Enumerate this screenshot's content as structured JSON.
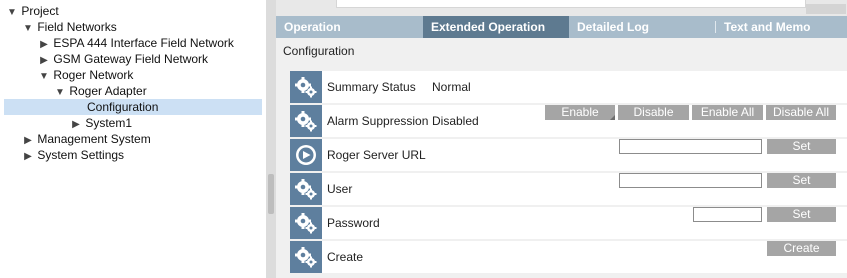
{
  "tree": {
    "items": [
      {
        "label": "Project",
        "toggle": "▼"
      },
      {
        "label": "Field Networks",
        "toggle": "▼"
      },
      {
        "label": "ESPA 444 Interface Field Network",
        "toggle": "▶"
      },
      {
        "label": "GSM Gateway Field Network",
        "toggle": "▶"
      },
      {
        "label": "Roger Network",
        "toggle": "▼"
      },
      {
        "label": "Roger Adapter",
        "toggle": "▼"
      },
      {
        "label": "Configuration",
        "toggle": ""
      },
      {
        "label": "System1",
        "toggle": "▶"
      },
      {
        "label": "Management System",
        "toggle": "▶"
      },
      {
        "label": "System Settings",
        "toggle": "▶"
      }
    ]
  },
  "tabs": [
    {
      "label": "Operation"
    },
    {
      "label": "Extended Operation"
    },
    {
      "label": "Detailed Log"
    },
    {
      "label": "Text and Memo"
    }
  ],
  "section_title": "Configuration",
  "rows": [
    {
      "label": "Summary Status",
      "value": "Normal",
      "icon": "gears-icon"
    },
    {
      "label": "Alarm Suppression",
      "value": "Disabled",
      "icon": "gears-icon",
      "buttons": [
        "Enable",
        "Disable",
        "Enable All",
        "Disable All"
      ]
    },
    {
      "label": "Roger Server URL",
      "icon": "play-circle-icon",
      "input_value": "",
      "button": "Set"
    },
    {
      "label": "User",
      "icon": "gears-icon",
      "input_value": "",
      "button": "Set"
    },
    {
      "label": "Password",
      "icon": "gears-icon",
      "input_value": "",
      "button": "Set"
    },
    {
      "label": "Create",
      "icon": "gears-icon",
      "button": "Create"
    }
  ],
  "colors": {
    "tab_bar": "#a8bccb",
    "tab_active": "#5e7a90",
    "icon_bg": "#5e7f9e",
    "button_bg": "#a5a5a5",
    "selection": "#cce0f4"
  }
}
